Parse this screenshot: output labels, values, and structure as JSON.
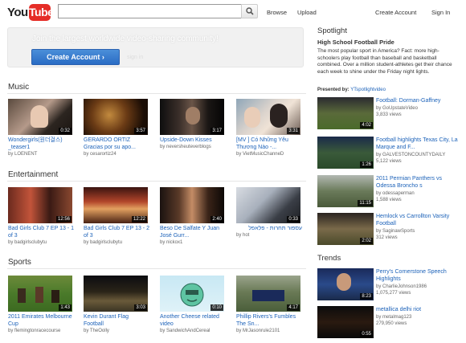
{
  "header": {
    "logo_you": "You",
    "logo_tube": "Tube",
    "search_value": "",
    "browse": "Browse",
    "upload": "Upload",
    "create_account": "Create Account",
    "sign_in": "Sign In"
  },
  "promo": {
    "text": "Join the largest worldwide video-sharing community!",
    "button": "Create Account ›",
    "faded": "sign in"
  },
  "sections": [
    {
      "title": "Music",
      "videos": [
        {
          "title": "Wondergirls(원더걸스) _teaser1",
          "by": "by LOENENT",
          "duration": "0:32"
        },
        {
          "title": "GERARDO ORTIZ Gracias por su apo...",
          "by": "by cesarortiz24",
          "duration": "3:57"
        },
        {
          "title": "Upside-Down Kisses",
          "by": "by neversheuteverblogs",
          "duration": "3:17"
        },
        {
          "title": "[MV ] Có Những Yêu Thương Nào -...",
          "by": "by VietMusicChanneD",
          "duration": "3:31"
        }
      ]
    },
    {
      "title": "Entertainment",
      "videos": [
        {
          "title": "Bad Girls Club 7 EP 13 - 1 of 3",
          "by": "by badgirlsclubytu",
          "duration": "12:56"
        },
        {
          "title": "Bad Girls Club 7 EP 13 - 2 of 3",
          "by": "by badgirlsclubytu",
          "duration": "12:22"
        },
        {
          "title": "Beso De Salfate Y Juan José Gurr...",
          "by": "by nickox1",
          "duration": "2:40"
        },
        {
          "title": "עספור תחרות - פלאפל",
          "by": "by hot",
          "duration": "0:33"
        }
      ]
    },
    {
      "title": "Sports",
      "videos": [
        {
          "title": "2011 Emirates Melbourne Cup",
          "by": "by flemingtonracecourse",
          "duration": "1:43"
        },
        {
          "title": "Kevin Durant Flag Football",
          "by": "by TheOolly",
          "duration": "3:03"
        },
        {
          "title": "Another Cheese related video",
          "by": "by SandwichAndCereal",
          "duration": "0:10"
        },
        {
          "title": "Phillip Rivers's Fumbles The Sn...",
          "by": "by MrJasonrule2101",
          "duration": "4:17"
        }
      ]
    }
  ],
  "spotlight": {
    "title": "Spotlight",
    "heading": "High School Football Pride",
    "description": "The most popular sport in America? Fact: more high-schoolers play football than baseball and basketball combined. Over a million student-athletes get their chance each week to shine under the Friday night lights.",
    "presented_label": "Presented by:",
    "presented_by": "YTspotlightvideo",
    "videos": [
      {
        "title": "Football: Dorman-Gaffney",
        "by": "by GoUpstateVideo",
        "views": "3,833 views",
        "duration": "4:02"
      },
      {
        "title": "Football highlights Texas City, La Marque and F...",
        "by": "by GALVESTONCOUNTYDAILY",
        "views": "5,122 views",
        "duration": "1:26"
      },
      {
        "title": "2011 Permian Panthers vs Odessa Broncho s",
        "by": "by odessaperman",
        "views": "1,588 views",
        "duration": "11:15"
      },
      {
        "title": "Hemlock vs Carrollton Varsity Football",
        "by": "by SaginawSports",
        "views": "312 views",
        "duration": "2:02"
      }
    ]
  },
  "trends": {
    "title": "Trends",
    "videos": [
      {
        "title": "Perry's Cornerstone Speech Highlights",
        "by": "by CharlieJohnson1986",
        "views": "1,075,277 views",
        "duration": "8:23"
      },
      {
        "title": "metallica delhi riot",
        "by": "by metalmag123",
        "views": "279,950 views",
        "duration": "0:55"
      }
    ]
  },
  "colors": {
    "link": "#1c62b9",
    "logo_red": "#e52d27",
    "button_blue": "#2a6cc4"
  }
}
